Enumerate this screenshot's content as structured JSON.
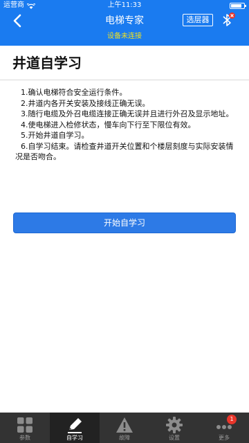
{
  "status_bar": {
    "carrier": "运营商",
    "time": "上午11:33",
    "battery_level": 0.85
  },
  "header": {
    "title": "电梯专家",
    "selector_label": "选层器",
    "connection_status": "设备未连接"
  },
  "main": {
    "page_title": "井道自学习",
    "steps": [
      {
        "num": "1.",
        "text": "确认电梯符合安全运行条件。"
      },
      {
        "num": "2.",
        "text": "井道内各开关安装及接线正确无误。"
      },
      {
        "num": "3.",
        "text": "随行电缆及外召电缆连接正确无误并且进行外召及显示地址。"
      },
      {
        "num": "4.",
        "text": "使电梯进入检修状态，慢车向下行至下限位有效。"
      },
      {
        "num": "5.",
        "text": "开始井道自学习。"
      },
      {
        "num": "6.",
        "text": "自学习结束。请检查井道开关位置和个楼层刻度与实际安装情况是否吻合。"
      }
    ],
    "start_button_label": "开始自学习"
  },
  "tabbar": {
    "tabs": [
      {
        "label": "参数",
        "icon": "grid-icon"
      },
      {
        "label": "自学习",
        "icon": "pencil-icon"
      },
      {
        "label": "故障",
        "icon": "warning-icon"
      },
      {
        "label": "设置",
        "icon": "gear-icon"
      },
      {
        "label": "更多",
        "icon": "more-icon",
        "badge": "1"
      }
    ]
  },
  "colors": {
    "accent": "#1a7bf0",
    "button": "#2d7ae6",
    "status_warning": "#f0e020",
    "tabbar": "#333333",
    "badge": "#e8352a"
  }
}
